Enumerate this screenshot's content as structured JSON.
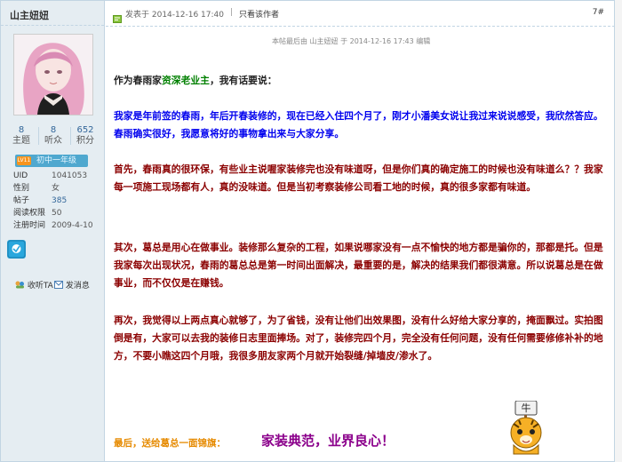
{
  "author": {
    "name": "山主妞妞",
    "stats": [
      {
        "value": "8",
        "label": "主题"
      },
      {
        "value": "8",
        "label": "听众"
      },
      {
        "value": "652",
        "label": "积分"
      }
    ],
    "rank": {
      "badge_text": "LV11",
      "title": "初中一年级"
    },
    "info": [
      {
        "key": "UID",
        "value": "1041053"
      },
      {
        "key": "性别",
        "value": "女"
      },
      {
        "key": "帖子",
        "value": "385"
      },
      {
        "key": "阅读权限",
        "value": "50"
      },
      {
        "key": "注册时间",
        "value": "2009-4-10"
      }
    ],
    "actions": {
      "follow": "收听TA",
      "message": "发消息"
    }
  },
  "post": {
    "posted_at": "发表于 2014-12-16 17:40",
    "separator": "|",
    "author_only": "只看该作者",
    "floor": "7#",
    "edit_note": "本帖最后由 山主妞妞 于 2014-12-16 17:43 编辑",
    "intro_pre": "作为春雨家",
    "intro_highlight": "资深老业主",
    "intro_post": "，我有话要说：",
    "p1": "我家是年前签的春雨，年后开春装修的，现在已经入住四个月了，刚才小潘美女说让我过来说说感受，我欣然答应。春雨确实很好，我愿意将好的事物拿出来与大家分享。",
    "p2": "首先，春雨真的很环保，有些业主说喔家装修完也没有味道呀，但是你们真的确定施工的时候也没有味道么？？我家每一项施工现场都有人，真的没味道。但是当初考察装修公司看工地的时候，真的很多家都有味道。",
    "p3": "其次，葛总是用心在做事业。装修那么复杂的工程，如果说哪家没有一点不愉快的地方都是骗你的，那都是托。但是我家每次出现状况，春雨的葛总总是第一时间出面解决，最重要的是，解决的结果我们都很满意。所以说葛总是在做事业，而不仅仅是在赚钱。",
    "p4": "再次，我觉得以上两点真心就够了，为了省钱，没有让他们出效果图，没有什么好给大家分享的，掩面飘过。实拍图倒是有，大家可以去我的装修日志里面捧场。对了，装修完四个月，完全没有任何问题，没有任何需要修修补补的地方，不要小瞧这四个月哦，我很多朋友家两个月就开始裂缝/掉墙皮/渗水了。",
    "final_lead": "最后，送给葛总一面锦旗：",
    "final_motto": "家装典范，业界良心！"
  },
  "colors": {
    "sidebar_bg": "#e5edf2",
    "border": "#c2d5e3",
    "blue_text": "#0000ee",
    "red_text": "#8b0000",
    "purple_text": "#8b008b",
    "orange_text": "#e68a00"
  },
  "icons": [
    "post-time-icon",
    "medal-icon",
    "follow-icon",
    "message-icon",
    "tiger-emoticon"
  ]
}
